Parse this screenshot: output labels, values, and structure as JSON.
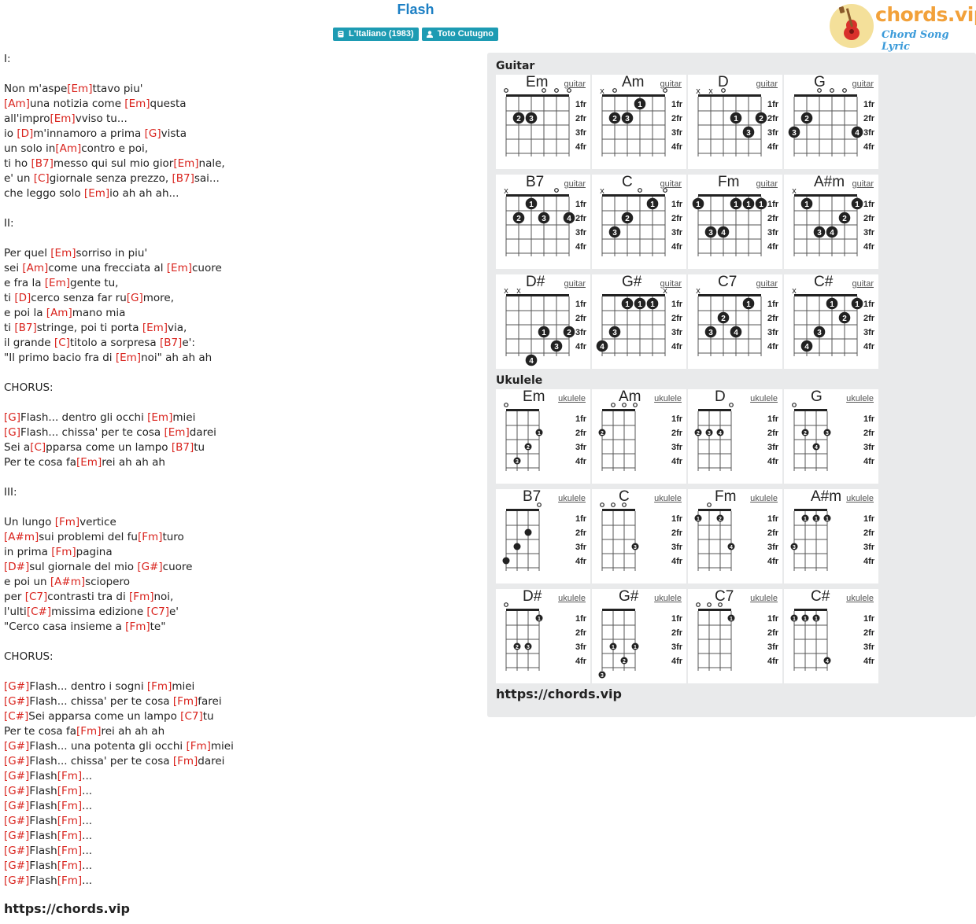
{
  "song": {
    "title": "Flash",
    "album": "L'Italiano (1983)",
    "artist": "Toto Cutugno"
  },
  "brand": {
    "name": "chords.vip",
    "tagline": "Chord Song Lyric",
    "primary_color": "#f2a13a",
    "accent_color": "#d9231d"
  },
  "site_url": "https://chords.vip",
  "lyrics": [
    "I:",
    "",
    "Non m'aspe[Em]ttavo piu'",
    "[Am]una notizia come [Em]questa",
    "all'impro[Em]vviso tu...",
    "io [D]m'innamoro a prima [G]vista",
    "un solo in[Am]contro e poi,",
    "ti ho [B7]messo qui sul mio gior[Em]nale,",
    "e' un [C]giornale senza prezzo, [B7]sai...",
    "che leggo solo [Em]io ah ah ah...",
    "",
    "II:",
    "",
    "Per quel [Em]sorriso in piu'",
    "sei [Am]come una frecciata al [Em]cuore",
    "e fra la [Em]gente tu,",
    "ti [D]cerco senza far ru[G]more,",
    "e poi la [Am]mano mia",
    "ti [B7]stringe, poi ti porta [Em]via,",
    "il grande [C]titolo a sorpresa [B7]e':",
    "\"Il primo bacio fra di [Em]noi\" ah ah ah",
    "",
    "CHORUS:",
    "",
    "[G]Flash... dentro gli occhi [Em]miei",
    "[G]Flash... chissa' per te cosa [Em]darei",
    "Sei a[C]pparsa come un lampo [B7]tu",
    "Per te cosa fa[Em]rei ah ah ah",
    "",
    "III:",
    "",
    "Un lungo [Fm]vertice",
    "[A#m]sui problemi del fu[Fm]turo",
    "in prima [Fm]pagina",
    "[D#]sul giornale del mio [G#]cuore",
    "e poi un [A#m]sciopero",
    "per [C7]contrasti tra di [Fm]noi,",
    "l'ulti[C#]missima edizione [C7]e'",
    "\"Cerco casa insieme a [Fm]te\"",
    "",
    "CHORUS:",
    "",
    "[G#]Flash... dentro i sogni [Fm]miei",
    "[G#]Flash... chissa' per te cosa [Fm]farei",
    "[C#]Sei apparsa come un lampo [C7]tu",
    "Per te cosa fa[Fm]rei ah ah ah",
    "[G#]Flash... una potenta gli occhi [Fm]miei",
    "[G#]Flash... chissa' per te cosa [Fm]darei",
    "[G#]Flash[Fm]...",
    "[G#]Flash[Fm]...",
    "[G#]Flash[Fm]...",
    "[G#]Flash[Fm]...",
    "[G#]Flash[Fm]...",
    "[G#]Flash[Fm]...",
    "[G#]Flash[Fm]...",
    "[G#]Flash[Fm]..."
  ],
  "fret_labels": [
    "1fr",
    "2fr",
    "3fr",
    "4fr"
  ],
  "guitar": {
    "label": "Guitar",
    "instrument": "guitar",
    "chords": [
      {
        "name": "Em",
        "open": [
          "o",
          "",
          "",
          "o",
          "o",
          "o"
        ],
        "dots": [
          [
            2,
            2,
            "2"
          ],
          [
            3,
            2,
            "3"
          ]
        ]
      },
      {
        "name": "Am",
        "open": [
          "x",
          "o",
          "",
          "",
          "",
          "o"
        ],
        "dots": [
          [
            2,
            2,
            "2"
          ],
          [
            3,
            2,
            "3"
          ],
          [
            4,
            1,
            "1"
          ]
        ]
      },
      {
        "name": "D",
        "open": [
          "x",
          "x",
          "o",
          "",
          "",
          ""
        ],
        "dots": [
          [
            4,
            2,
            "1"
          ],
          [
            5,
            3,
            "3"
          ],
          [
            6,
            2,
            "2"
          ]
        ]
      },
      {
        "name": "G",
        "open": [
          "",
          "",
          "o",
          "o",
          "o",
          ""
        ],
        "dots": [
          [
            1,
            3,
            "3"
          ],
          [
            2,
            2,
            "2"
          ],
          [
            6,
            3,
            "4"
          ]
        ]
      },
      {
        "name": "B7",
        "open": [
          "x",
          "",
          "",
          "",
          "o",
          ""
        ],
        "dots": [
          [
            2,
            2,
            "2"
          ],
          [
            3,
            1,
            "1"
          ],
          [
            4,
            2,
            "3"
          ],
          [
            6,
            2,
            "4"
          ]
        ]
      },
      {
        "name": "C",
        "open": [
          "x",
          "",
          "",
          "o",
          "",
          "o"
        ],
        "dots": [
          [
            2,
            3,
            "3"
          ],
          [
            3,
            2,
            "2"
          ],
          [
            5,
            1,
            "1"
          ]
        ]
      },
      {
        "name": "Fm",
        "open": [
          "",
          "",
          "",
          "",
          "",
          ""
        ],
        "dots": [
          [
            1,
            1,
            "1"
          ],
          [
            2,
            3,
            "3"
          ],
          [
            3,
            3,
            "4"
          ],
          [
            4,
            1,
            "1"
          ],
          [
            5,
            1,
            "1"
          ],
          [
            6,
            1,
            "1"
          ]
        ]
      },
      {
        "name": "A#m",
        "open": [
          "x",
          "",
          "",
          "",
          "",
          ""
        ],
        "dots": [
          [
            2,
            1,
            "1"
          ],
          [
            3,
            3,
            "3"
          ],
          [
            4,
            3,
            "4"
          ],
          [
            5,
            2,
            "2"
          ],
          [
            6,
            1,
            "1"
          ]
        ]
      },
      {
        "name": "D#",
        "open": [
          "x",
          "x",
          "",
          "",
          "",
          ""
        ],
        "dots": [
          [
            3,
            5,
            "4"
          ],
          [
            4,
            3,
            "1"
          ],
          [
            5,
            4,
            "3"
          ],
          [
            6,
            3,
            "2"
          ]
        ]
      },
      {
        "name": "G#",
        "open": [
          "",
          "",
          "",
          "",
          "",
          "x"
        ],
        "dots": [
          [
            1,
            4,
            "4"
          ],
          [
            2,
            3,
            "3"
          ],
          [
            3,
            1,
            "1"
          ],
          [
            4,
            1,
            "1"
          ],
          [
            5,
            1,
            "1"
          ]
        ]
      },
      {
        "name": "C7",
        "open": [
          "x",
          "",
          "",
          "",
          "",
          ""
        ],
        "dots": [
          [
            2,
            3,
            "3"
          ],
          [
            3,
            2,
            "2"
          ],
          [
            4,
            3,
            "4"
          ],
          [
            5,
            1,
            "1"
          ]
        ]
      },
      {
        "name": "C#",
        "open": [
          "x",
          "",
          "",
          "",
          "",
          ""
        ],
        "dots": [
          [
            2,
            4,
            "4"
          ],
          [
            3,
            3,
            "3"
          ],
          [
            4,
            1,
            "1"
          ],
          [
            5,
            2,
            "2"
          ],
          [
            6,
            1,
            "1"
          ]
        ]
      }
    ]
  },
  "ukulele": {
    "label": "Ukulele",
    "instrument": "ukulele",
    "chords": [
      {
        "name": "Em",
        "open": [
          "o",
          "",
          "",
          ""
        ],
        "dots": [
          [
            2,
            4,
            "3"
          ],
          [
            3,
            3,
            "2"
          ],
          [
            4,
            2,
            "1"
          ]
        ]
      },
      {
        "name": "Am",
        "open": [
          "",
          "o",
          "o",
          "o"
        ],
        "dots": [
          [
            1,
            2,
            "2"
          ]
        ]
      },
      {
        "name": "D",
        "open": [
          "",
          "",
          "",
          "o"
        ],
        "dots": [
          [
            1,
            2,
            "2"
          ],
          [
            2,
            2,
            "3"
          ],
          [
            3,
            2,
            "4"
          ]
        ]
      },
      {
        "name": "G",
        "open": [
          "o",
          "",
          "",
          ""
        ],
        "dots": [
          [
            2,
            2,
            "2"
          ],
          [
            3,
            3,
            "4"
          ],
          [
            4,
            2,
            "3"
          ]
        ]
      },
      {
        "name": "B7",
        "open": [
          "",
          "",
          "",
          "o"
        ],
        "dots": [
          [
            1,
            4,
            ""
          ],
          [
            2,
            3,
            ""
          ],
          [
            3,
            2,
            ""
          ]
        ]
      },
      {
        "name": "C",
        "open": [
          "o",
          "o",
          "o",
          ""
        ],
        "dots": [
          [
            4,
            3,
            "3"
          ]
        ]
      },
      {
        "name": "Fm",
        "open": [
          "",
          "o",
          "",
          ""
        ],
        "dots": [
          [
            1,
            1,
            "1"
          ],
          [
            3,
            1,
            "2"
          ],
          [
            4,
            3,
            "4"
          ]
        ]
      },
      {
        "name": "A#m",
        "open": [
          "",
          "",
          "",
          ""
        ],
        "dots": [
          [
            1,
            3,
            "3"
          ],
          [
            2,
            1,
            "1"
          ],
          [
            3,
            1,
            "1"
          ],
          [
            4,
            1,
            "1"
          ]
        ]
      },
      {
        "name": "D#",
        "open": [
          "o",
          "",
          "",
          ""
        ],
        "dots": [
          [
            2,
            3,
            "2"
          ],
          [
            3,
            3,
            "3"
          ],
          [
            4,
            1,
            "1"
          ]
        ]
      },
      {
        "name": "G#",
        "open": [
          "",
          "",
          "",
          ""
        ],
        "dots": [
          [
            1,
            5,
            "3"
          ],
          [
            2,
            3,
            "1"
          ],
          [
            3,
            4,
            "2"
          ],
          [
            4,
            3,
            "1"
          ]
        ]
      },
      {
        "name": "C7",
        "open": [
          "o",
          "o",
          "o",
          ""
        ],
        "dots": [
          [
            4,
            1,
            "1"
          ]
        ]
      },
      {
        "name": "C#",
        "open": [
          "",
          "",
          "",
          ""
        ],
        "dots": [
          [
            1,
            1,
            "1"
          ],
          [
            2,
            1,
            "1"
          ],
          [
            3,
            1,
            "1"
          ],
          [
            4,
            4,
            "4"
          ]
        ]
      }
    ]
  }
}
